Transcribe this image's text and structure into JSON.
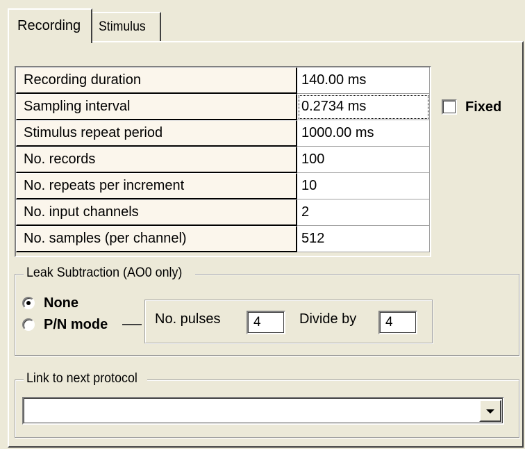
{
  "tabs": [
    {
      "label": "Recording",
      "active": true
    },
    {
      "label": "Stimulus",
      "active": false
    }
  ],
  "grid": {
    "rows": [
      {
        "label": "Recording duration",
        "value": "140.00 ms"
      },
      {
        "label": "Sampling interval",
        "value": "0.2734 ms"
      },
      {
        "label": "Stimulus repeat period",
        "value": "1000.00 ms"
      },
      {
        "label": "No. records",
        "value": "100"
      },
      {
        "label": "No. repeats per increment",
        "value": "10"
      },
      {
        "label": "No. input channels",
        "value": "2"
      },
      {
        "label": "No. samples (per channel)",
        "value": "512"
      }
    ]
  },
  "fixed_checkbox": {
    "label": "Fixed",
    "checked": false
  },
  "leak_subtraction": {
    "title": "Leak Subtraction (AO0 only)",
    "options": [
      {
        "label": "None",
        "selected": true
      },
      {
        "label": "P/N mode",
        "selected": false
      }
    ],
    "pulses_label": "No. pulses",
    "pulses_value": "4",
    "divide_label": "Divide by",
    "divide_value": "4"
  },
  "link_protocol": {
    "title": "Link to next protocol",
    "value": ""
  },
  "colors": {
    "window_bg": "#ece9d8",
    "label_cell_bg": "#fbf6ec",
    "value_cell_bg": "#ffffff"
  }
}
